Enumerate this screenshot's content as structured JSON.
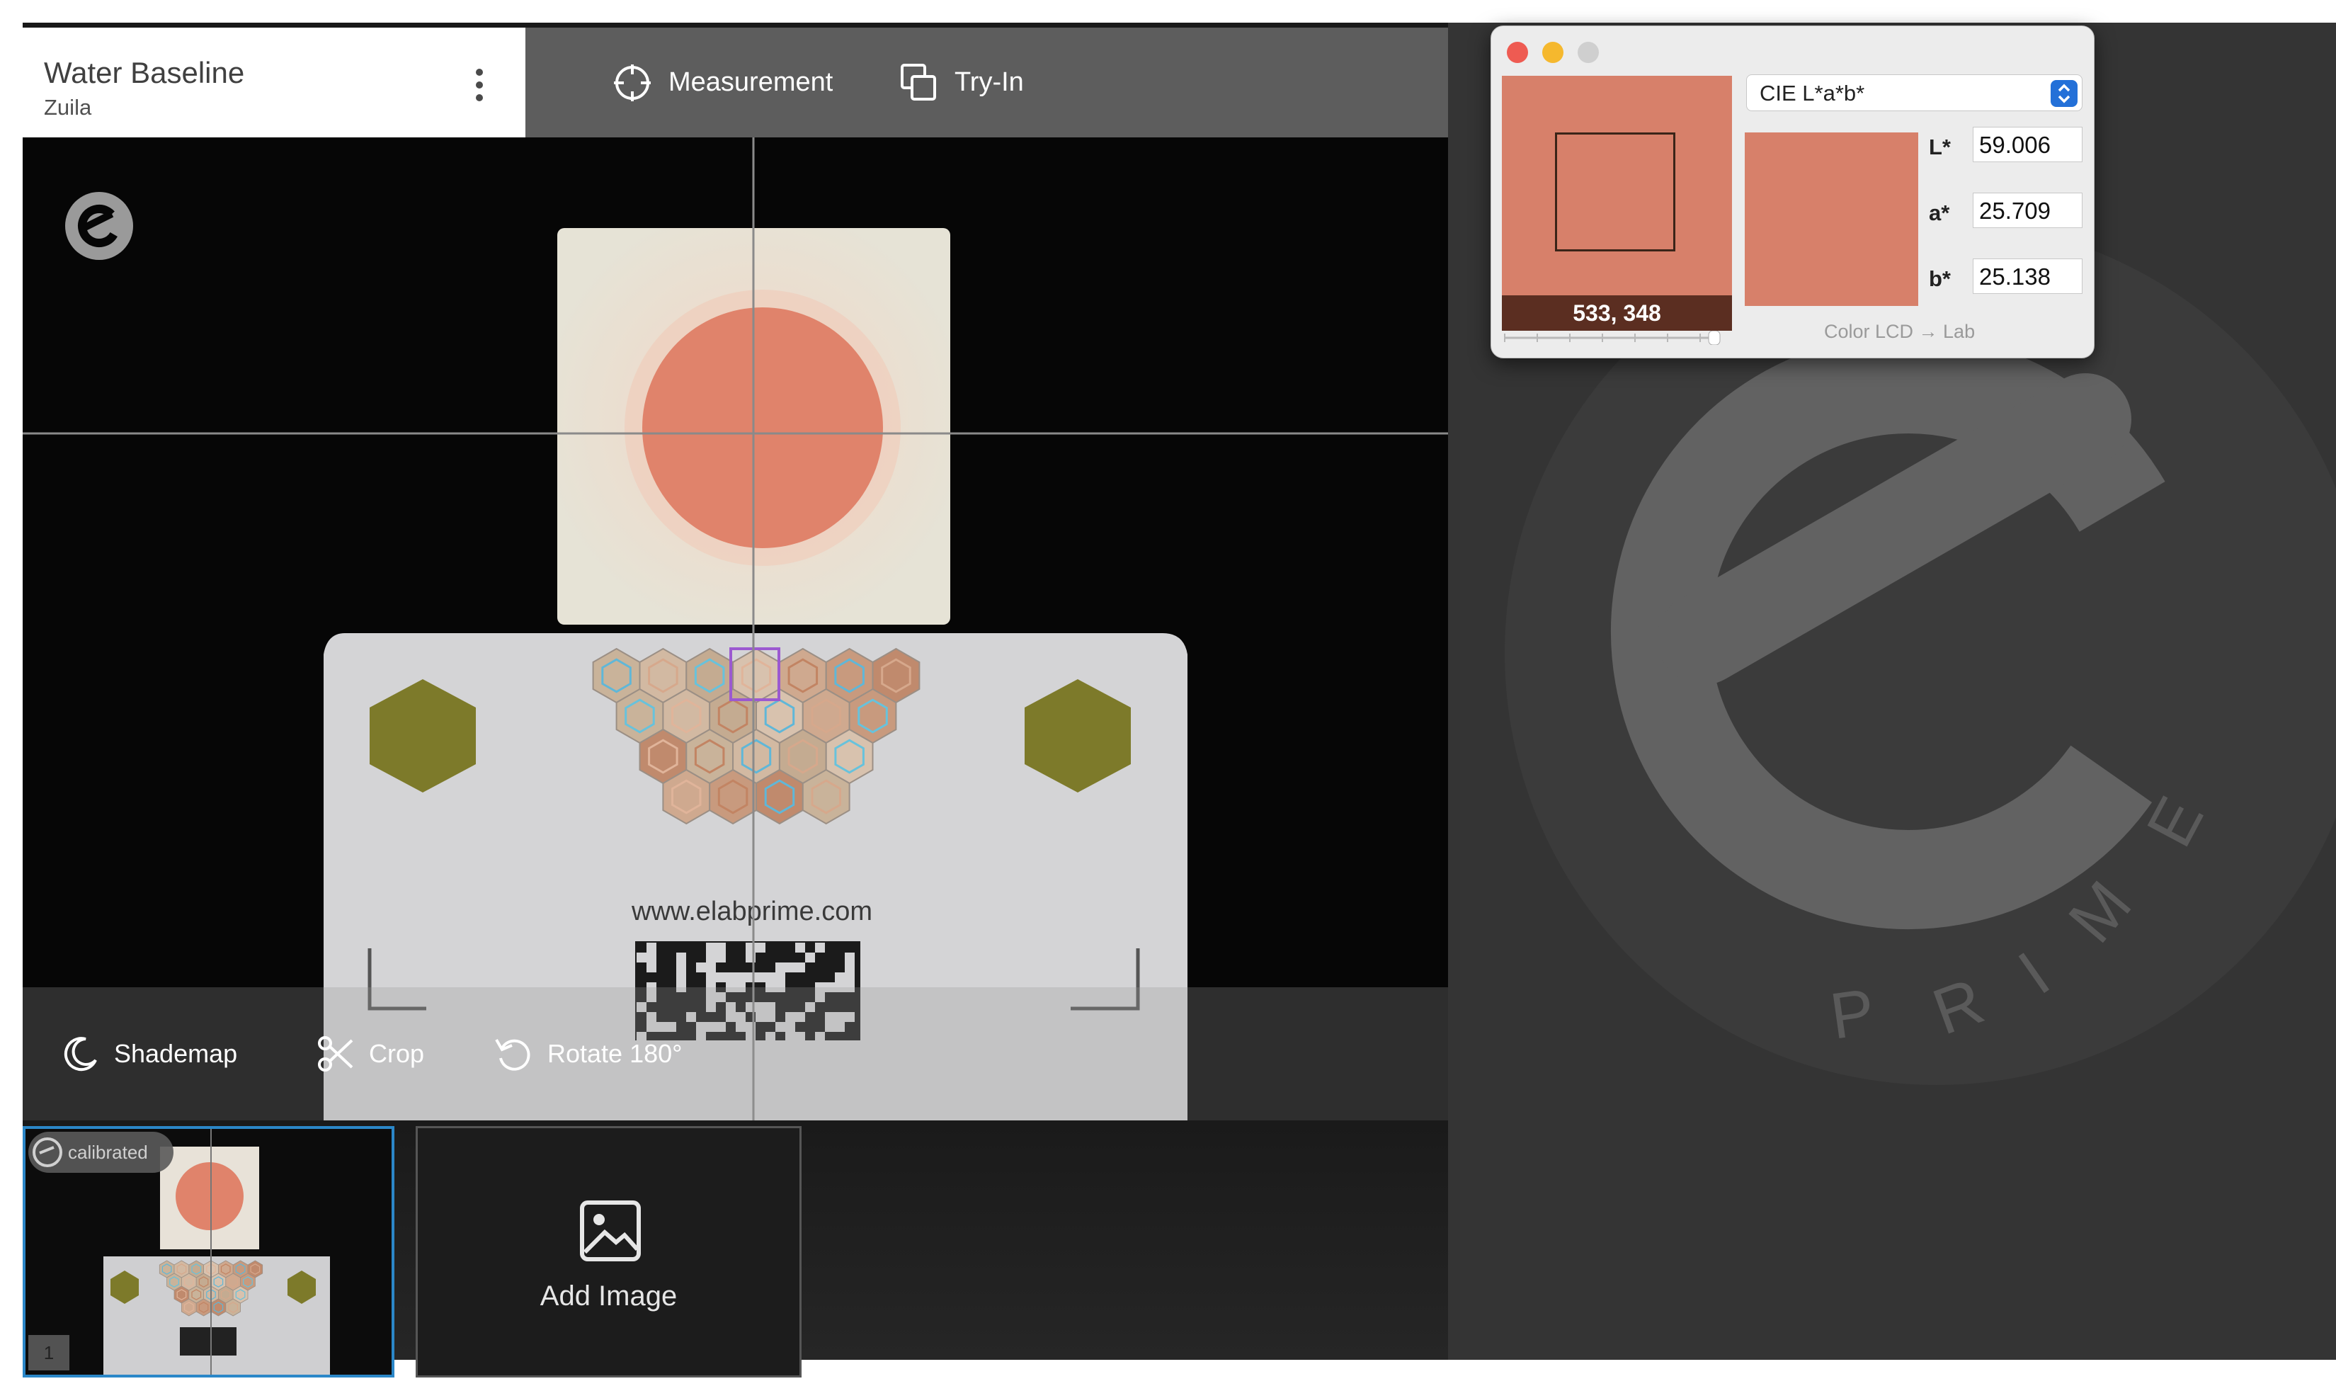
{
  "header": {
    "title": "Water Baseline",
    "subtitle": "Zuila"
  },
  "top_tabs": [
    {
      "label": "Measurement",
      "icon": "crosshair-icon"
    },
    {
      "label": "Try-In",
      "icon": "copy-icon"
    }
  ],
  "viewer": {
    "card_url": "www.elabprime.com"
  },
  "tools": [
    {
      "label": "Shademap",
      "icon": "moon-icon"
    },
    {
      "label": "Crop",
      "icon": "scissors-icon"
    },
    {
      "label": "Rotate 180°",
      "icon": "rotate-icon"
    }
  ],
  "thumbnail": {
    "badge": "calibrated",
    "index": "1"
  },
  "add_image": {
    "label": "Add Image"
  },
  "color_panel": {
    "coords": "533, 348",
    "mode": "CIE L*a*b*",
    "labels": {
      "L": "L*",
      "a": "a*",
      "b": "b*"
    },
    "values": {
      "L": "59.006",
      "a": "25.709",
      "b": "25.138"
    },
    "profile": "Color LCD → Lab",
    "sample_color": "#d7806a"
  },
  "brand": {
    "word": "PRIME"
  }
}
